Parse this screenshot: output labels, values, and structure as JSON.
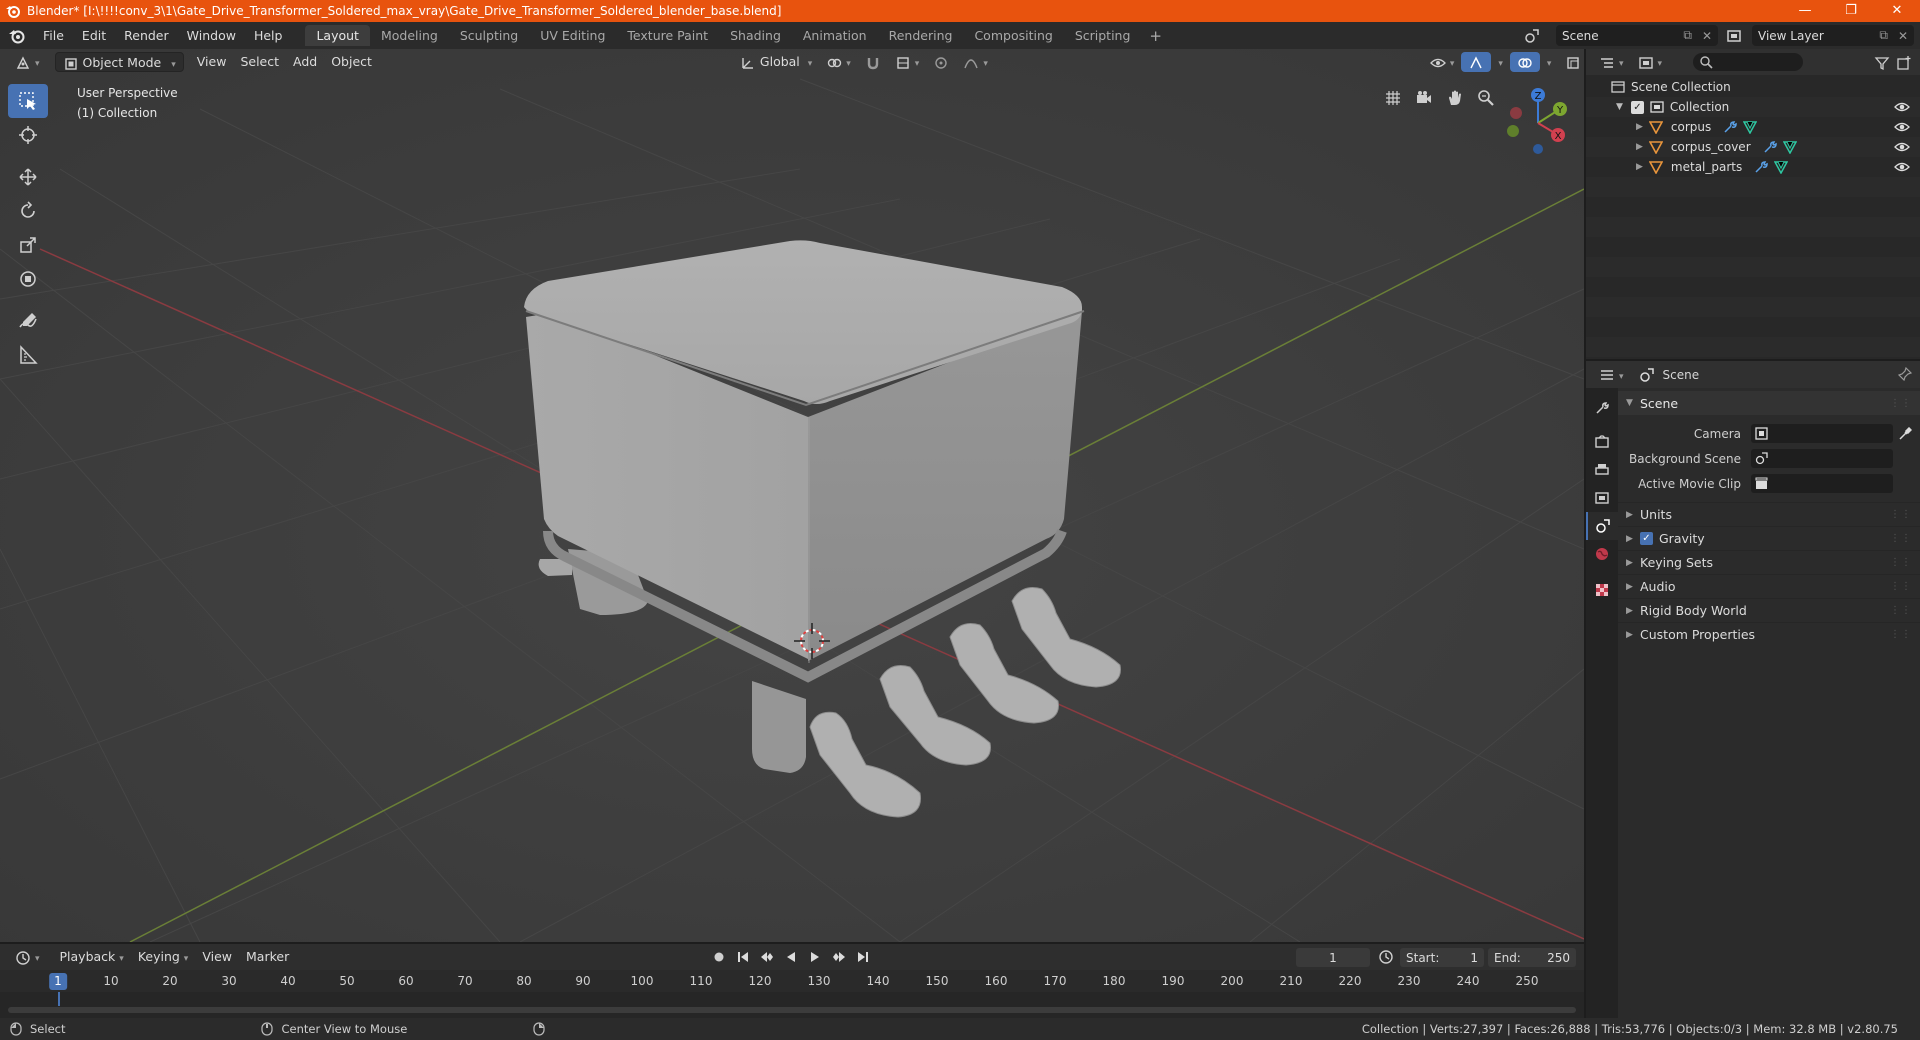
{
  "window": {
    "title": "Blender* [I:\\!!!!conv_3\\1\\Gate_Drive_Transformer_Soldered_max_vray\\Gate_Drive_Transformer_Soldered_blender_base.blend]",
    "minimize": "—",
    "maximize": "❐",
    "close": "✕"
  },
  "menubar": {
    "items": [
      "File",
      "Edit",
      "Render",
      "Window",
      "Help"
    ],
    "workspaces": [
      "Layout",
      "Modeling",
      "Sculpting",
      "UV Editing",
      "Texture Paint",
      "Shading",
      "Animation",
      "Rendering",
      "Compositing",
      "Scripting"
    ],
    "active_workspace": "Layout",
    "add_workspace": "+",
    "scene_name": "Scene",
    "view_layer_name": "View Layer"
  },
  "viewport": {
    "mode": "Object Mode",
    "menus": [
      "View",
      "Select",
      "Add",
      "Object"
    ],
    "orientation": "Global",
    "perspective_label": "User Perspective",
    "collection_label": "(1) Collection",
    "gizmo_axes": {
      "x": "X",
      "y": "Y",
      "z": "Z"
    },
    "icons": [
      "select-box-icon",
      "cursor-icon",
      "move-icon",
      "rotate-icon",
      "scale-icon",
      "transform-icon",
      "annotate-icon",
      "measure-icon"
    ]
  },
  "outliner": {
    "root": "Scene Collection",
    "collection": "Collection",
    "objects": [
      "corpus",
      "corpus_cover",
      "metal_parts"
    ]
  },
  "properties": {
    "context": "Scene",
    "panel_title": "Scene",
    "rows": [
      {
        "label": "Camera",
        "value": ""
      },
      {
        "label": "Background Scene",
        "value": ""
      },
      {
        "label": "Active Movie Clip",
        "value": ""
      }
    ],
    "subpanels": [
      "Units",
      "Gravity",
      "Keying Sets",
      "Audio",
      "Rigid Body World",
      "Custom Properties"
    ],
    "gravity_checked": true
  },
  "timeline": {
    "menus": [
      "Playback",
      "Keying",
      "View",
      "Marker"
    ],
    "current_frame": "1",
    "start_label": "Start:",
    "start": "1",
    "end_label": "End:",
    "end": "250",
    "ticks": [
      "10",
      "20",
      "30",
      "40",
      "50",
      "60",
      "70",
      "80",
      "90",
      "100",
      "110",
      "120",
      "130",
      "140",
      "150",
      "160",
      "170",
      "180",
      "190",
      "200",
      "210",
      "220",
      "230",
      "240",
      "250"
    ],
    "marker": "1"
  },
  "statusbar": {
    "select": "Select",
    "center_view": "Center View to Mouse",
    "stats": "Collection | Verts:27,397 | Faces:26,888 | Tris:53,776 | Objects:0/3 | Mem: 32.8 MB | v2.80.75"
  },
  "colors": {
    "title_bar": "#e8530e",
    "accent": "#4772b3",
    "x_axis": "#d1404f",
    "y_axis": "#7da630",
    "z_axis": "#3c7bd7",
    "object_icon": "#e8953c",
    "modifier_icon": "#5aa1e8",
    "mesh_icon": "#2ec9a3"
  }
}
